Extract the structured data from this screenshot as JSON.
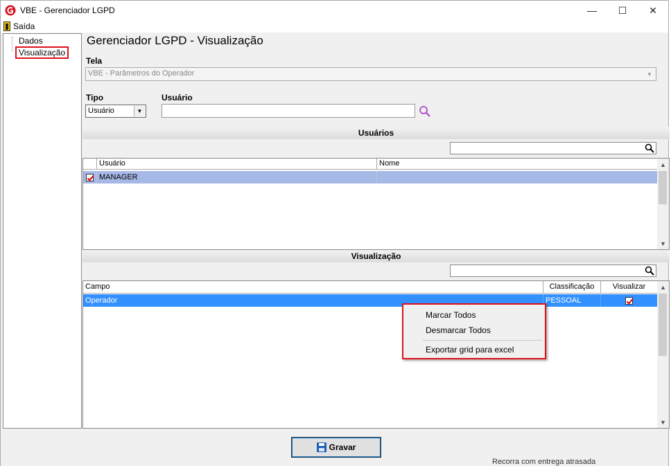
{
  "window": {
    "title": "VBE - Gerenciador LGPD",
    "minimize": "—",
    "maximize": "☐",
    "close": "✕"
  },
  "menu": {
    "saida": "Saída"
  },
  "tree": {
    "dados": "Dados",
    "visualizacao": "Visualização"
  },
  "page": {
    "title": "Gerenciador LGPD - Visualização"
  },
  "form": {
    "tela_label": "Tela",
    "tela_value": "VBE - Parâmetros do Operador",
    "tipo_label": "Tipo",
    "tipo_value": "Usuário",
    "usuario_label": "Usuário",
    "usuario_value": ""
  },
  "usuarios_section": {
    "header": "Usuários",
    "filter_value": "",
    "columns": [
      "Usuário",
      "Nome"
    ],
    "rows": [
      {
        "usuario": "MANAGER",
        "nome": "",
        "checked": true
      }
    ]
  },
  "visualizacao_section": {
    "header": "Visualização",
    "filter_value": "",
    "columns": [
      "Campo",
      "Classificação",
      "Visualizar"
    ],
    "rows": [
      {
        "campo": "Operador",
        "classificacao": "PESSOAL",
        "visualizar": true
      }
    ]
  },
  "context_menu": {
    "items": [
      "Marcar Todos",
      "Desmarcar Todos",
      "Exportar grid para excel"
    ]
  },
  "footer": {
    "gravar": "Gravar"
  },
  "background": {
    "partial_text": "Recorra com entrega atrasada"
  },
  "colors": {
    "selected_row_user": "#a6b8e6",
    "selected_row_vis": "#3390ff",
    "highlight_box": "#e0101a"
  }
}
